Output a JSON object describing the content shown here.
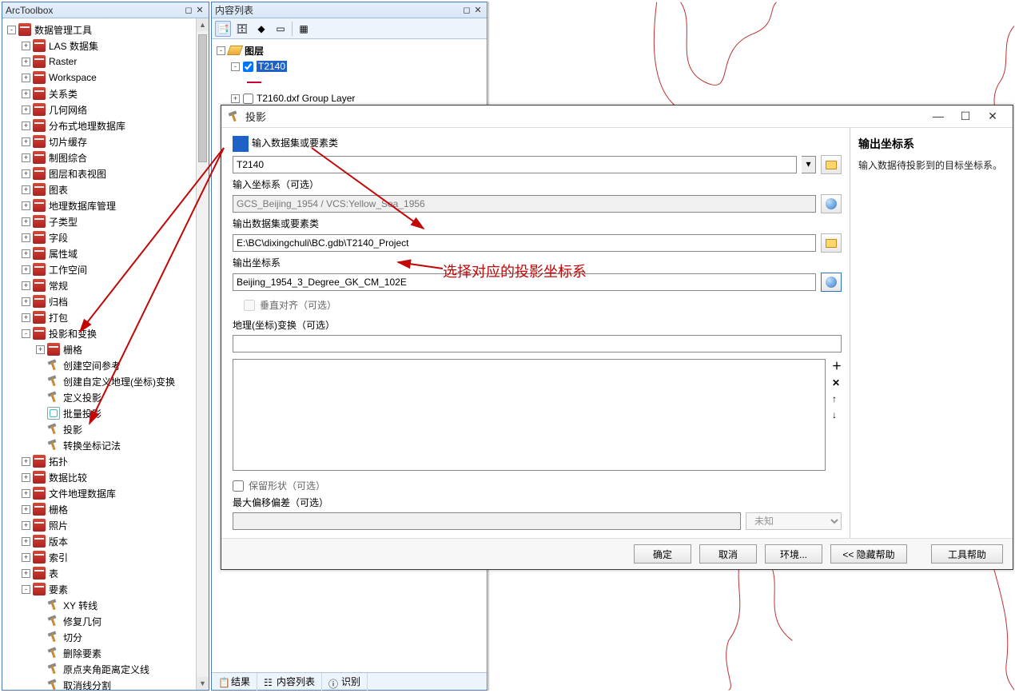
{
  "arctoolbox": {
    "title": "ArcToolbox",
    "root_expand": "-",
    "root_label": "数据管理工具",
    "items": [
      {
        "exp": "+",
        "ico": "toolbox",
        "label": "LAS 数据集",
        "d": 1
      },
      {
        "exp": "+",
        "ico": "toolbox",
        "label": "Raster",
        "d": 1
      },
      {
        "exp": "+",
        "ico": "toolbox",
        "label": "Workspace",
        "d": 1
      },
      {
        "exp": "+",
        "ico": "toolbox",
        "label": "关系类",
        "d": 1
      },
      {
        "exp": "+",
        "ico": "toolbox",
        "label": "几何网络",
        "d": 1
      },
      {
        "exp": "+",
        "ico": "toolbox",
        "label": "分布式地理数据库",
        "d": 1
      },
      {
        "exp": "+",
        "ico": "toolbox",
        "label": "切片缓存",
        "d": 1
      },
      {
        "exp": "+",
        "ico": "toolbox",
        "label": "制图综合",
        "d": 1
      },
      {
        "exp": "+",
        "ico": "toolbox",
        "label": "图层和表视图",
        "d": 1
      },
      {
        "exp": "+",
        "ico": "toolbox",
        "label": "图表",
        "d": 1
      },
      {
        "exp": "+",
        "ico": "toolbox",
        "label": "地理数据库管理",
        "d": 1
      },
      {
        "exp": "+",
        "ico": "toolbox",
        "label": "子类型",
        "d": 1
      },
      {
        "exp": "+",
        "ico": "toolbox",
        "label": "字段",
        "d": 1
      },
      {
        "exp": "+",
        "ico": "toolbox",
        "label": "属性域",
        "d": 1
      },
      {
        "exp": "+",
        "ico": "toolbox",
        "label": "工作空间",
        "d": 1
      },
      {
        "exp": "+",
        "ico": "toolbox",
        "label": "常规",
        "d": 1
      },
      {
        "exp": "+",
        "ico": "toolbox",
        "label": "归档",
        "d": 1
      },
      {
        "exp": "+",
        "ico": "toolbox",
        "label": "打包",
        "d": 1
      },
      {
        "exp": "-",
        "ico": "toolbox",
        "label": "投影和变换",
        "d": 1
      },
      {
        "exp": "+",
        "ico": "toolbox",
        "label": "栅格",
        "d": 2
      },
      {
        "exp": "",
        "ico": "hammer",
        "label": "创建空间参考",
        "d": 2
      },
      {
        "exp": "",
        "ico": "hammer",
        "label": "创建自定义地理(坐标)变换",
        "d": 2
      },
      {
        "exp": "",
        "ico": "hammer",
        "label": "定义投影",
        "d": 2
      },
      {
        "exp": "",
        "ico": "script",
        "label": "批量投影",
        "d": 2
      },
      {
        "exp": "",
        "ico": "hammer",
        "label": "投影",
        "d": 2
      },
      {
        "exp": "",
        "ico": "hammer",
        "label": "转换坐标记法",
        "d": 2
      },
      {
        "exp": "+",
        "ico": "toolbox",
        "label": "拓扑",
        "d": 1
      },
      {
        "exp": "+",
        "ico": "toolbox",
        "label": "数据比较",
        "d": 1
      },
      {
        "exp": "+",
        "ico": "toolbox",
        "label": "文件地理数据库",
        "d": 1
      },
      {
        "exp": "+",
        "ico": "toolbox",
        "label": "栅格",
        "d": 1
      },
      {
        "exp": "+",
        "ico": "toolbox",
        "label": "照片",
        "d": 1
      },
      {
        "exp": "+",
        "ico": "toolbox",
        "label": "版本",
        "d": 1
      },
      {
        "exp": "+",
        "ico": "toolbox",
        "label": "索引",
        "d": 1
      },
      {
        "exp": "+",
        "ico": "toolbox",
        "label": "表",
        "d": 1
      },
      {
        "exp": "-",
        "ico": "toolbox",
        "label": "要素",
        "d": 1
      },
      {
        "exp": "",
        "ico": "hammer",
        "label": "XY 转线",
        "d": 2
      },
      {
        "exp": "",
        "ico": "hammer",
        "label": "修复几何",
        "d": 2
      },
      {
        "exp": "",
        "ico": "hammer",
        "label": "切分",
        "d": 2
      },
      {
        "exp": "",
        "ico": "hammer",
        "label": "删除要素",
        "d": 2
      },
      {
        "exp": "",
        "ico": "hammer",
        "label": "原点夹角距离定义线",
        "d": 2
      },
      {
        "exp": "",
        "ico": "hammer",
        "label": "取消线分割",
        "d": 2
      }
    ]
  },
  "contents": {
    "title": "内容列表",
    "layers_label": "图层",
    "layer_t2140": "T2140",
    "layer_group": "T2160.dxf Group Layer",
    "tabs": {
      "results": "结果",
      "toc": "内容列表",
      "identify": "识别"
    }
  },
  "dialog": {
    "title": "投影",
    "input_ds_label": "输入数据集或要素类",
    "input_ds_value": "T2140",
    "input_cs_label": "输入坐标系（可选）",
    "input_cs_value": "GCS_Beijing_1954 / VCS:Yellow_Sea_1956",
    "output_ds_label": "输出数据集或要素类",
    "output_ds_value": "E:\\BC\\dixingchuli\\BC.gdb\\T2140_Project",
    "output_cs_label": "输出坐标系",
    "output_cs_value": "Beijing_1954_3_Degree_GK_CM_102E",
    "vertical_label": "垂直对齐（可选）",
    "geo_trans_label": "地理(坐标)变换（可选）",
    "preserve_shape_label": "保留形状（可选）",
    "max_offset_label": "最大偏移偏差（可选）",
    "unknown": "未知",
    "side_title": "输出坐标系",
    "side_desc": "输入数据待投影到的目标坐标系。",
    "buttons": {
      "ok": "确定",
      "cancel": "取消",
      "env": "环境...",
      "hidehelp": "<< 隐藏帮助",
      "toolhelp": "工具帮助"
    }
  },
  "annotation": "选择对应的投影坐标系"
}
